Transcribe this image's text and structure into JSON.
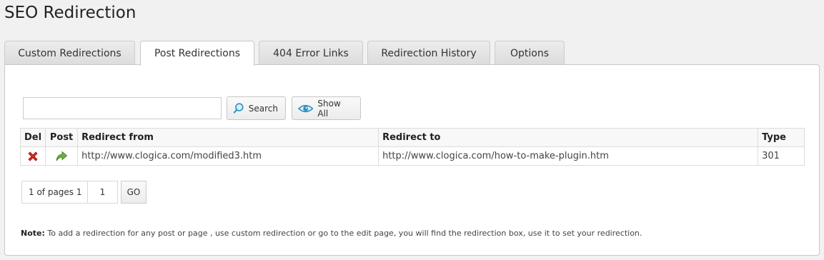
{
  "page": {
    "title": "SEO Redirection"
  },
  "tabs": [
    {
      "label": "Custom Redirections",
      "active": false
    },
    {
      "label": "Post Redirections",
      "active": true
    },
    {
      "label": "404 Error Links",
      "active": false
    },
    {
      "label": "Redirection History",
      "active": false
    },
    {
      "label": "Options",
      "active": false
    }
  ],
  "search": {
    "value": "",
    "button_label": "Search",
    "show_all_label": "Show All"
  },
  "table": {
    "headers": {
      "del": "Del",
      "post": "Post",
      "from": "Redirect from",
      "to": "Redirect to",
      "type": "Type"
    },
    "rows": [
      {
        "from": "http://www.clogica.com/modified3.htm",
        "to": "http://www.clogica.com/how-to-make-plugin.htm",
        "type": "301"
      }
    ]
  },
  "pager": {
    "info": "1 of pages 1",
    "page_value": "1",
    "go_label": "GO"
  },
  "note": {
    "label": "Note:",
    "text": " To add a redirection for any post or page , use custom redirection or go to the edit page, you will find the redirection box, use it to set your redirection."
  },
  "icons": {
    "delete": "delete-x-icon",
    "post": "green-arrow-icon",
    "search": "magnifier-icon",
    "show_all": "eye-icon"
  },
  "colors": {
    "delete": "#d9281d",
    "post_arrow": "#5aa02c",
    "eye": "#2a8fc0"
  }
}
